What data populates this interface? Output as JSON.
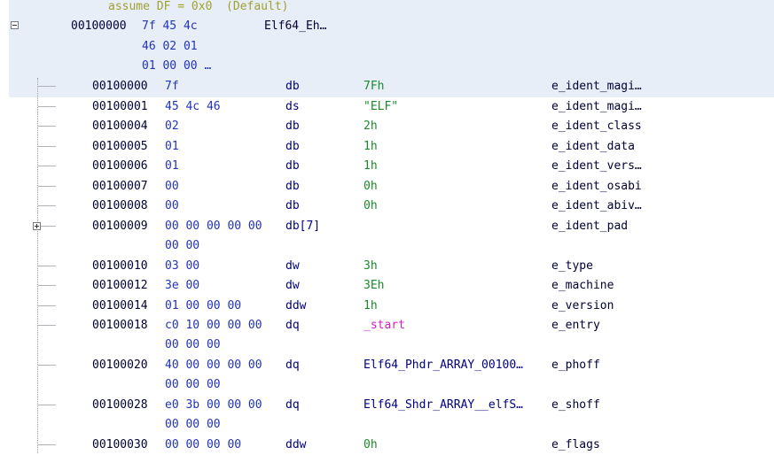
{
  "assume": "assume DF = 0x0  (Default)",
  "header": {
    "addr": "00100000",
    "bytes_line1": "7f 45 4c",
    "label": "Elf64_Eh…",
    "bytes_line2": "46 02 01",
    "bytes_line3": "01 00 00 …"
  },
  "rows": [
    {
      "addr": "00100000",
      "bytes": "7f",
      "mnemonic": "db",
      "operand": "7Fh",
      "field": "e_ident_magi…"
    },
    {
      "addr": "00100001",
      "bytes": "45 4c 46",
      "mnemonic": "ds",
      "operand": "\"ELF\"",
      "field": "e_ident_magi…"
    },
    {
      "addr": "00100004",
      "bytes": "02",
      "mnemonic": "db",
      "operand": "2h",
      "field": "e_ident_class"
    },
    {
      "addr": "00100005",
      "bytes": "01",
      "mnemonic": "db",
      "operand": "1h",
      "field": "e_ident_data"
    },
    {
      "addr": "00100006",
      "bytes": "01",
      "mnemonic": "db",
      "operand": "1h",
      "field": "e_ident_vers…"
    },
    {
      "addr": "00100007",
      "bytes": "00",
      "mnemonic": "db",
      "operand": "0h",
      "field": "e_ident_osabi"
    },
    {
      "addr": "00100008",
      "bytes": "00",
      "mnemonic": "db",
      "operand": "0h",
      "field": "e_ident_abiv…"
    },
    {
      "addr": "00100009",
      "bytes": "00 00 00 00 00",
      "bytes2": "00 00",
      "mnemonic": "db[7]",
      "operand": "",
      "field": "e_ident_pad"
    },
    {
      "addr": "00100010",
      "bytes": "03 00",
      "mnemonic": "dw",
      "operand": "3h",
      "field": "e_type"
    },
    {
      "addr": "00100012",
      "bytes": "3e 00",
      "mnemonic": "dw",
      "operand": "3Eh",
      "field": "e_machine"
    },
    {
      "addr": "00100014",
      "bytes": "01 00 00 00",
      "mnemonic": "ddw",
      "operand": "1h",
      "field": "e_version"
    },
    {
      "addr": "00100018",
      "bytes": "c0 10 00 00 00",
      "bytes2": "00 00 00",
      "mnemonic": "dq",
      "operand": "_start",
      "field": "e_entry"
    },
    {
      "addr": "00100020",
      "bytes": "40 00 00 00 00",
      "bytes2": "00 00 00",
      "mnemonic": "dq",
      "operand": "Elf64_Phdr_ARRAY_00100…",
      "field": "e_phoff"
    },
    {
      "addr": "00100028",
      "bytes": "e0 3b 00 00 00",
      "bytes2": "00 00 00",
      "mnemonic": "dq",
      "operand": "Elf64_Shdr_ARRAY__elfS…",
      "field": "e_shoff"
    },
    {
      "addr": "00100030",
      "bytes": "00 00 00 00",
      "mnemonic": "ddw",
      "operand": "0h",
      "field": "e_flags"
    }
  ]
}
